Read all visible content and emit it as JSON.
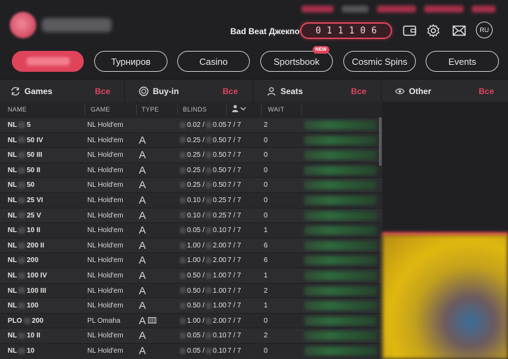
{
  "header": {
    "jackpot_label": "Bad Beat Джекпот",
    "jackpot_digits": [
      "0",
      "1",
      "1",
      "1",
      "0",
      "6"
    ],
    "lang": "RU"
  },
  "nav": {
    "pills": [
      {
        "label": "",
        "active": true
      },
      {
        "label": "Турниров"
      },
      {
        "label": "Casino"
      },
      {
        "label": "Sportsbook",
        "badge": "NEW"
      },
      {
        "label": "Cosmic Spins"
      },
      {
        "label": "Events"
      }
    ]
  },
  "filters": {
    "games": {
      "label": "Games",
      "value": "Все"
    },
    "buyin": {
      "label": "Buy-in",
      "value": "Все"
    },
    "seats": {
      "label": "Seats",
      "value": "Все"
    },
    "other": {
      "label": "Other",
      "value": "Все"
    }
  },
  "table": {
    "headers": {
      "name": "NAME",
      "game": "GAME",
      "type": "TYPE",
      "blinds": "BLINDS",
      "wait": "WAIT"
    },
    "rows": [
      {
        "name_a": "NL",
        "name_b": "5",
        "game": "NL Hold'em",
        "type": "",
        "blinds_a": "0.02 /",
        "blinds_b": "0.05",
        "seats": "7 / 7",
        "wait": "2"
      },
      {
        "name_a": "NL",
        "name_b": "50 IV",
        "game": "NL Hold'em",
        "type": "A",
        "blinds_a": "0.25 /",
        "blinds_b": "0.50",
        "seats": "7 / 7",
        "wait": "0"
      },
      {
        "name_a": "NL",
        "name_b": "50 III",
        "game": "NL Hold'em",
        "type": "A",
        "blinds_a": "0.25 /",
        "blinds_b": "0.50",
        "seats": "7 / 7",
        "wait": "0"
      },
      {
        "name_a": "NL",
        "name_b": "50 II",
        "game": "NL Hold'em",
        "type": "A",
        "blinds_a": "0.25 /",
        "blinds_b": "0.50",
        "seats": "7 / 7",
        "wait": "0"
      },
      {
        "name_a": "NL",
        "name_b": "50",
        "game": "NL Hold'em",
        "type": "A",
        "blinds_a": "0.25 /",
        "blinds_b": "0.50",
        "seats": "7 / 7",
        "wait": "0"
      },
      {
        "name_a": "NL",
        "name_b": "25 VI",
        "game": "NL Hold'em",
        "type": "A",
        "blinds_a": "0.10 /",
        "blinds_b": "0.25",
        "seats": "7 / 7",
        "wait": "0"
      },
      {
        "name_a": "NL",
        "name_b": "25 V",
        "game": "NL Hold'em",
        "type": "A",
        "blinds_a": "0.10 /",
        "blinds_b": "0.25",
        "seats": "7 / 7",
        "wait": "0"
      },
      {
        "name_a": "NL",
        "name_b": "10 II",
        "game": "NL Hold'em",
        "type": "A",
        "blinds_a": "0.05 /",
        "blinds_b": "0.10",
        "seats": "7 / 7",
        "wait": "1"
      },
      {
        "name_a": "NL",
        "name_b": "200 II",
        "game": "NL Hold'em",
        "type": "A",
        "blinds_a": "1.00 /",
        "blinds_b": "2.00",
        "seats": "7 / 7",
        "wait": "6"
      },
      {
        "name_a": "NL",
        "name_b": "200",
        "game": "NL Hold'em",
        "type": "A",
        "blinds_a": "1.00 /",
        "blinds_b": "2.00",
        "seats": "7 / 7",
        "wait": "6"
      },
      {
        "name_a": "NL",
        "name_b": "100 IV",
        "game": "NL Hold'em",
        "type": "A",
        "blinds_a": "0.50 /",
        "blinds_b": "1.00",
        "seats": "7 / 7",
        "wait": "1"
      },
      {
        "name_a": "NL",
        "name_b": "100 III",
        "game": "NL Hold'em",
        "type": "A",
        "blinds_a": "0.50 /",
        "blinds_b": "1.00",
        "seats": "7 / 7",
        "wait": "2"
      },
      {
        "name_a": "NL",
        "name_b": "100",
        "game": "NL Hold'em",
        "type": "A",
        "blinds_a": "0.50 /",
        "blinds_b": "1.00",
        "seats": "7 / 7",
        "wait": "1"
      },
      {
        "name_a": "PLO",
        "name_b": "200",
        "game": "PL Omaha",
        "type": "A",
        "blinds_a": "1.00 /",
        "blinds_b": "2.00",
        "seats": "7 / 7",
        "wait": "0"
      },
      {
        "name_a": "NL",
        "name_b": "10 II",
        "game": "NL Hold'em",
        "type": "A",
        "blinds_a": "0.05 /",
        "blinds_b": "0.10",
        "seats": "7 / 7",
        "wait": "2"
      },
      {
        "name_a": "NL",
        "name_b": "10",
        "game": "NL Hold'em",
        "type": "A",
        "blinds_a": "0.05 /",
        "blinds_b": "0.10",
        "seats": "7 / 7",
        "wait": "0"
      }
    ]
  },
  "colors": {
    "accent": "#e0445b",
    "bg": "#1f1f22"
  }
}
